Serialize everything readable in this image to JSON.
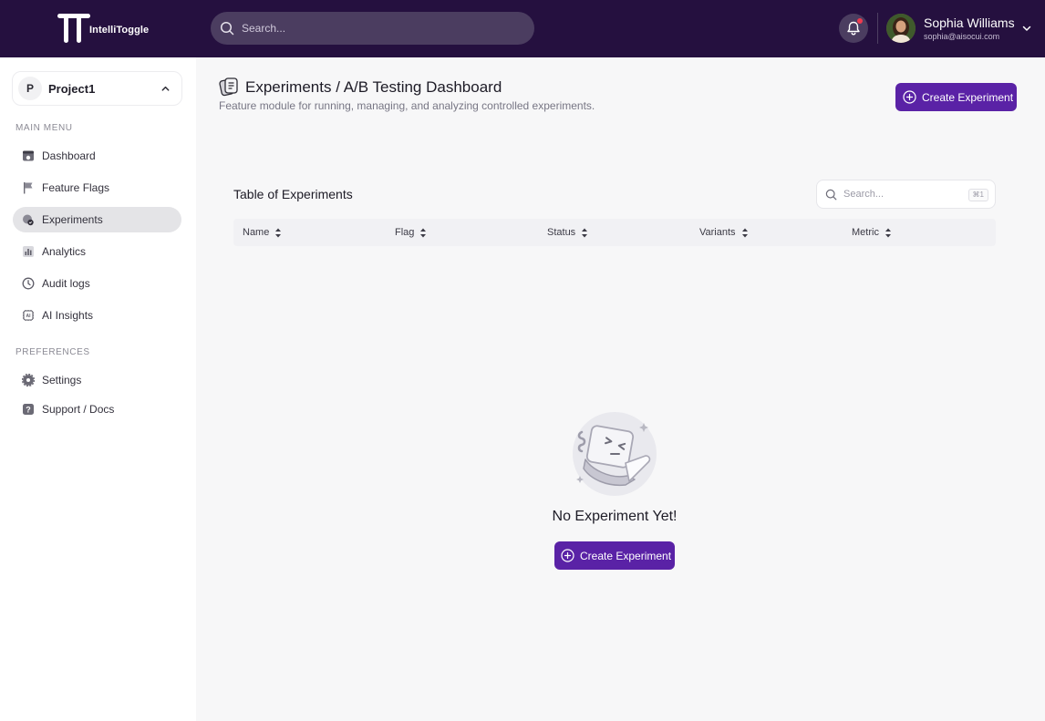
{
  "app": {
    "name": "IntelliToggle"
  },
  "topbar": {
    "search_placeholder": "Search...",
    "user": {
      "name": "Sophia Williams",
      "email": "sophia@aisocui.com"
    }
  },
  "sidebar": {
    "project": {
      "initial": "P",
      "name": "Project1"
    },
    "main_menu_title": "MAIN MENU",
    "main_menu": [
      {
        "label": "Dashboard",
        "icon": "dashboard-icon",
        "active": false
      },
      {
        "label": "Feature Flags",
        "icon": "flag-icon",
        "active": false
      },
      {
        "label": "Experiments",
        "icon": "experiments-icon",
        "active": true
      },
      {
        "label": "Analytics",
        "icon": "analytics-icon",
        "active": false
      },
      {
        "label": "Audit logs",
        "icon": "clock-icon",
        "active": false
      },
      {
        "label": "AI Insights",
        "icon": "ai-icon",
        "active": false
      }
    ],
    "preferences_title": "PREFERENCES",
    "preferences": [
      {
        "label": "Settings",
        "icon": "gear-icon"
      },
      {
        "label": "Support / Docs",
        "icon": "help-icon"
      }
    ]
  },
  "page": {
    "title": "Experiments / A/B Testing Dashboard",
    "subtitle": "Feature module for running, managing, and analyzing controlled experiments.",
    "create_label": "Create Experiment"
  },
  "table": {
    "title": "Table of Experiments",
    "search_placeholder": "Search...",
    "shortcut": "⌘1",
    "columns": [
      "Name",
      "Flag",
      "Status",
      "Variants",
      "Metric"
    ]
  },
  "empty_state": {
    "title": "No Experiment Yet!",
    "button_label": "Create Experiment"
  },
  "colors": {
    "topbar": "#25103f",
    "accent": "#5a22a6",
    "notification": "#ef3b4f"
  }
}
